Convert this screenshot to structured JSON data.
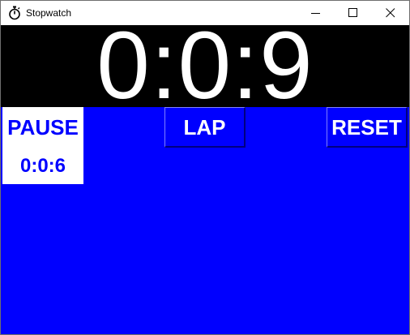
{
  "window": {
    "title": "Stopwatch",
    "icon": "stopwatch-icon",
    "controls": [
      "minimize-icon",
      "maximize-icon",
      "close-icon"
    ]
  },
  "display": {
    "time": "0:0:9"
  },
  "buttons": {
    "pause_label": "PAUSE",
    "lap_label": "LAP",
    "reset_label": "RESET"
  },
  "laps": [
    "0:0:6"
  ],
  "colors": {
    "background": "#0000ff",
    "display_bg": "#000000",
    "display_text": "#ffffff",
    "active_button_bg": "#ffffff",
    "accent_text": "#0000ff"
  }
}
